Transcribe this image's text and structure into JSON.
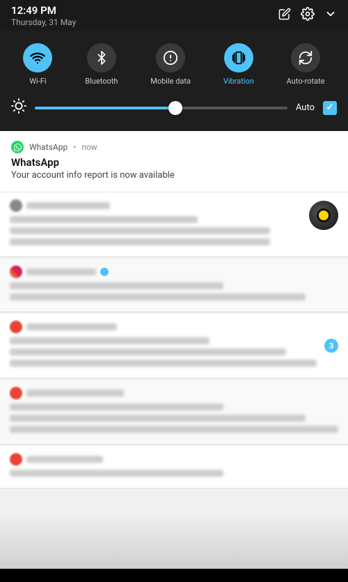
{
  "statusBar": {
    "time": "12:49 PM",
    "date": "Thursday, 31 May"
  },
  "quickSettings": {
    "tiles": [
      {
        "id": "wifi",
        "label": "Wi-Fi",
        "active": true,
        "icon": "wifi"
      },
      {
        "id": "bluetooth",
        "label": "Bluetooth",
        "active": false,
        "icon": "bluetooth"
      },
      {
        "id": "mobile-data",
        "label": "Mobile data",
        "active": false,
        "icon": "mobile"
      },
      {
        "id": "vibration",
        "label": "Vibration",
        "active": true,
        "icon": "vibration"
      },
      {
        "id": "auto-rotate",
        "label": "Auto-rotate",
        "active": false,
        "icon": "rotate"
      }
    ],
    "brightness": {
      "autoLabel": "Auto",
      "checkmark": "✓"
    }
  },
  "whatsappNotification": {
    "appName": "WhatsApp",
    "dot": "•",
    "time": "now",
    "title": "WhatsApp",
    "body": "Your account info report is now available"
  },
  "blurredNotifications": [
    {
      "id": "notif-1",
      "hasAvatar": true,
      "lines": [
        "short-header",
        "medium-title",
        "long-body",
        "long-body2"
      ]
    },
    {
      "id": "notif-2",
      "hasAvatar": false,
      "lines": [
        "short-header",
        "medium-title",
        "long-body"
      ]
    },
    {
      "id": "notif-3",
      "hasAvatar": false,
      "hasBadge": true,
      "badgeCount": "3",
      "lines": [
        "short-header",
        "medium-title",
        "long-body",
        "long-body2"
      ]
    },
    {
      "id": "notif-4",
      "hasAvatar": false,
      "lines": [
        "short-header",
        "medium-title",
        "long-body",
        "long-body2"
      ]
    },
    {
      "id": "notif-5",
      "hasAvatar": false,
      "lines": [
        "short-header",
        "medium-title"
      ]
    }
  ]
}
